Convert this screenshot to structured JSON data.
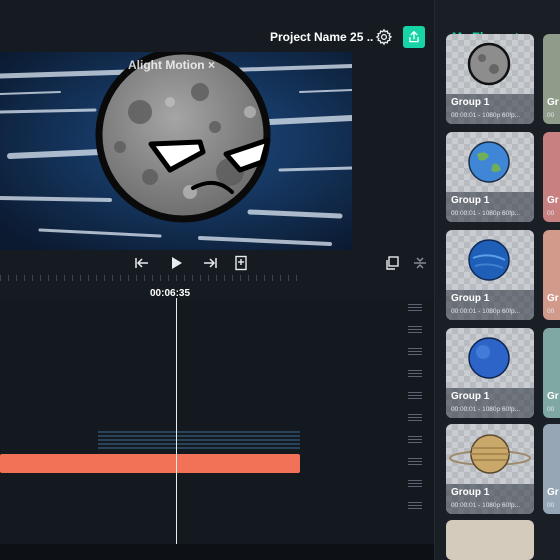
{
  "header": {
    "project_title": "Project Name 25 ..",
    "settings_icon": "gear-icon",
    "export_icon": "share-export-icon",
    "accent_color": "#17d4a6"
  },
  "preview": {
    "watermark": "Alight Motion ×"
  },
  "playback": {
    "icons": [
      "skip-to-start-icon",
      "play-icon",
      "skip-to-end-icon",
      "bookmark-icon",
      "copy-layers-icon",
      "collapse-icon"
    ],
    "timecode": "00:06:35"
  },
  "timeline": {
    "track_color": "#f27257"
  },
  "panel": {
    "tab_label": "My Elements",
    "cards": [
      {
        "name": "Group 1",
        "meta": "00:00:01 - 1080p 60fp...",
        "planet": "moon"
      },
      {
        "name": "Group 1",
        "meta": "00:00:01 - 1080p 60fp...",
        "planet": "earth"
      },
      {
        "name": "Group 1",
        "meta": "00:00:01 - 1080p 60fp...",
        "planet": "neptune"
      },
      {
        "name": "Group 1",
        "meta": "00:00:01 - 1080p 60fp...",
        "planet": "blue-planet"
      },
      {
        "name": "Group 1",
        "meta": "00:00:01 - 1080p 60fp...",
        "planet": "saturn"
      }
    ],
    "side_cards": [
      {
        "name": "Gr",
        "meta": "00"
      },
      {
        "name": "Gr",
        "meta": "00"
      },
      {
        "name": "Gr",
        "meta": "00"
      },
      {
        "name": "Gr",
        "meta": "00"
      },
      {
        "name": "Gr",
        "meta": "00"
      }
    ]
  }
}
